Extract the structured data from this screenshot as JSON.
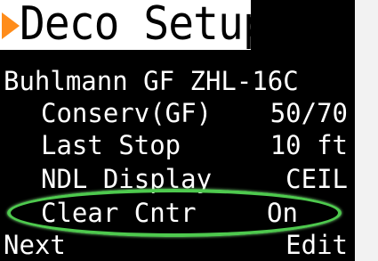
{
  "header": {
    "title": "Deco Setup"
  },
  "algorithm": "Buhlmann GF ZHL-16C",
  "settings": [
    {
      "label": "Conserv(GF)",
      "value": "50/70"
    },
    {
      "label": "Last Stop",
      "value": "10 ft"
    },
    {
      "label": "NDL Display",
      "value": "CEIL"
    },
    {
      "label": "Clear Cntr",
      "value": "On"
    }
  ],
  "footer": {
    "left": "Next",
    "right": "Edit"
  },
  "colors": {
    "arrow": "#ff8c1a",
    "highlight": "#4ec94e"
  },
  "icons": {
    "title_marker": "orange-right-triangle-icon"
  }
}
